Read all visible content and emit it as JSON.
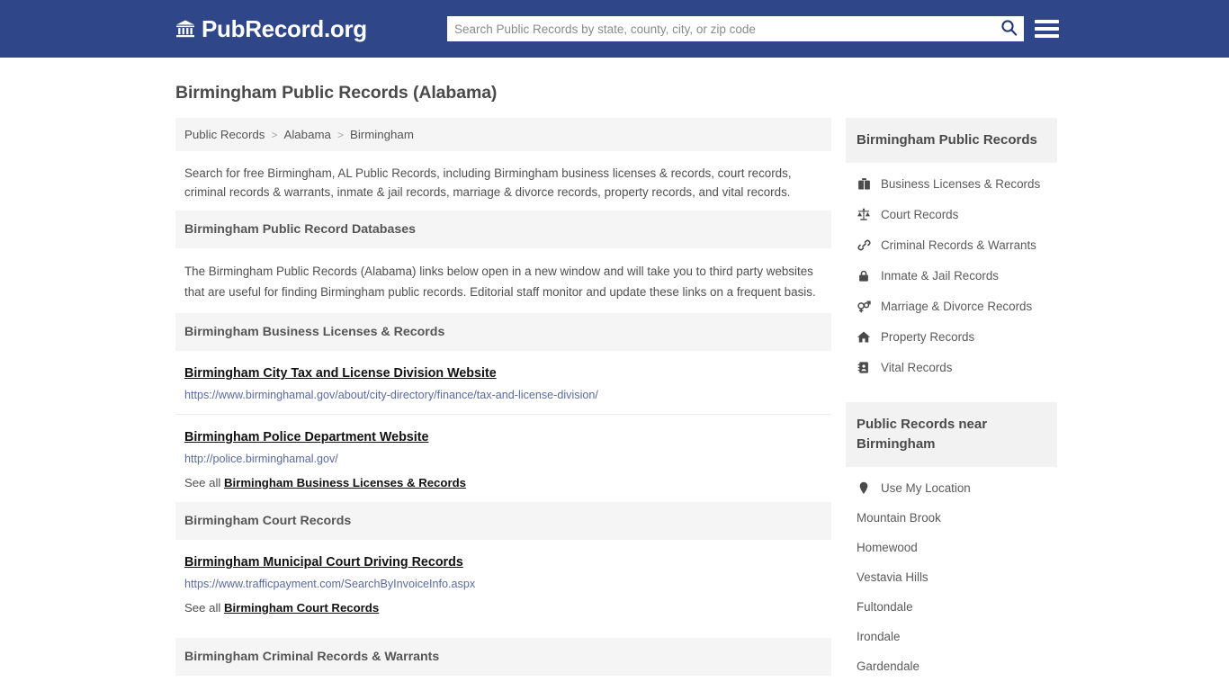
{
  "header": {
    "brand_text": "PubRecord.org",
    "brand_icon": "bank-icon",
    "search_placeholder": "Search Public Records by state, county, city, or zip code",
    "search_value": "",
    "search_icon": "search-icon",
    "menu_icon": "hamburger-menu-icon",
    "bg_color": "#2f4788"
  },
  "page": {
    "title": "Birmingham Public Records (Alabama)"
  },
  "breadcrumb": {
    "items": [
      "Public Records",
      "Alabama",
      "Birmingham"
    ],
    "separator": ">"
  },
  "intro": {
    "text": "Search for free Birmingham, AL Public Records, including Birmingham business licenses & records, court records, criminal records & warrants, inmate & jail records, marriage & divorce records, property records, and vital records."
  },
  "sections": [
    {
      "heading": "Birmingham Public Record Databases",
      "body": "The Birmingham Public Records (Alabama) links below open in a new window and will take you to third party websites that are useful for finding Birmingham public records. Editorial staff monitor and update these links on a frequent basis.",
      "entries": [],
      "see_all_prefix": "",
      "see_all_label": ""
    },
    {
      "heading": "Birmingham Business Licenses & Records",
      "body": "",
      "entries": [
        {
          "title": "Birmingham City Tax and License Division Website",
          "url": "https://www.birminghamal.gov/about/city-directory/finance/tax-and-license-division/"
        },
        {
          "title": "Birmingham Police Department Website",
          "url": "http://police.birminghamal.gov/"
        }
      ],
      "see_all_prefix": "See all",
      "see_all_label": "Birmingham Business Licenses & Records"
    },
    {
      "heading": "Birmingham Court Records",
      "body": "",
      "entries": [
        {
          "title": "Birmingham Municipal Court Driving Records",
          "url": "https://www.trafficpayment.com/SearchByInvoiceInfo.aspx"
        }
      ],
      "see_all_prefix": "See all",
      "see_all_label": "Birmingham Court Records"
    },
    {
      "heading": "Birmingham Criminal Records & Warrants",
      "body": "",
      "entries": [],
      "see_all_prefix": "",
      "see_all_label": ""
    }
  ],
  "sidebar": {
    "records_heading": "Birmingham Public Records",
    "records_items": [
      {
        "label": "Business Licenses & Records",
        "icon": "briefcase-icon"
      },
      {
        "label": "Court Records",
        "icon": "scales-icon"
      },
      {
        "label": "Criminal Records & Warrants",
        "icon": "chain-link-icon"
      },
      {
        "label": "Inmate & Jail Records",
        "icon": "lock-icon"
      },
      {
        "label": "Marriage & Divorce Records",
        "icon": "venus-mars-icon"
      },
      {
        "label": "Property Records",
        "icon": "home-icon"
      },
      {
        "label": "Vital Records",
        "icon": "address-book-icon"
      }
    ],
    "near_heading": "Public Records near Birmingham",
    "near_items": [
      {
        "label": "Use My Location",
        "icon": "map-pin-icon"
      },
      {
        "label": "Mountain Brook",
        "icon": ""
      },
      {
        "label": "Homewood",
        "icon": ""
      },
      {
        "label": "Vestavia Hills",
        "icon": ""
      },
      {
        "label": "Fultondale",
        "icon": ""
      },
      {
        "label": "Irondale",
        "icon": ""
      },
      {
        "label": "Gardendale",
        "icon": ""
      }
    ]
  }
}
